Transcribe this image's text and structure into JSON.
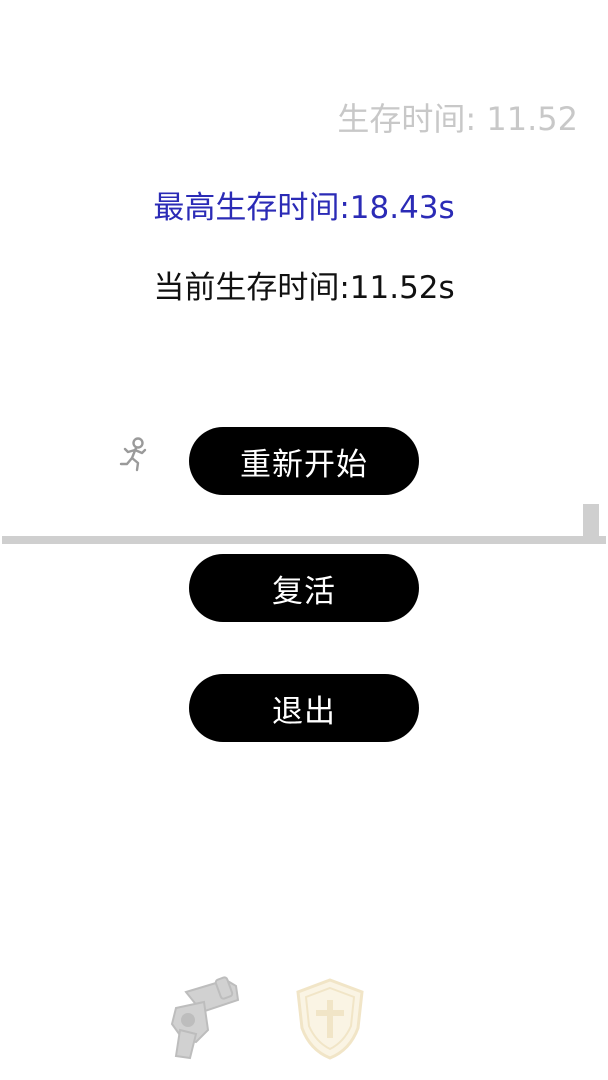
{
  "hud": {
    "survival_time_label": "生存时间: 11.52"
  },
  "game_over": {
    "best_time": "最高生存时间:18.43s",
    "current_time": "当前生存时间:11.52s",
    "restart_label": "重新开始",
    "revive_label": "复活",
    "exit_label": "退出"
  },
  "items": [
    {
      "icon": "gun-icon"
    },
    {
      "icon": "shield-icon"
    }
  ],
  "colors": {
    "best_time": "#2b2bb6",
    "hud_text": "#c8c8c8",
    "button_bg": "#000000",
    "ground": "#cfcfcf"
  }
}
